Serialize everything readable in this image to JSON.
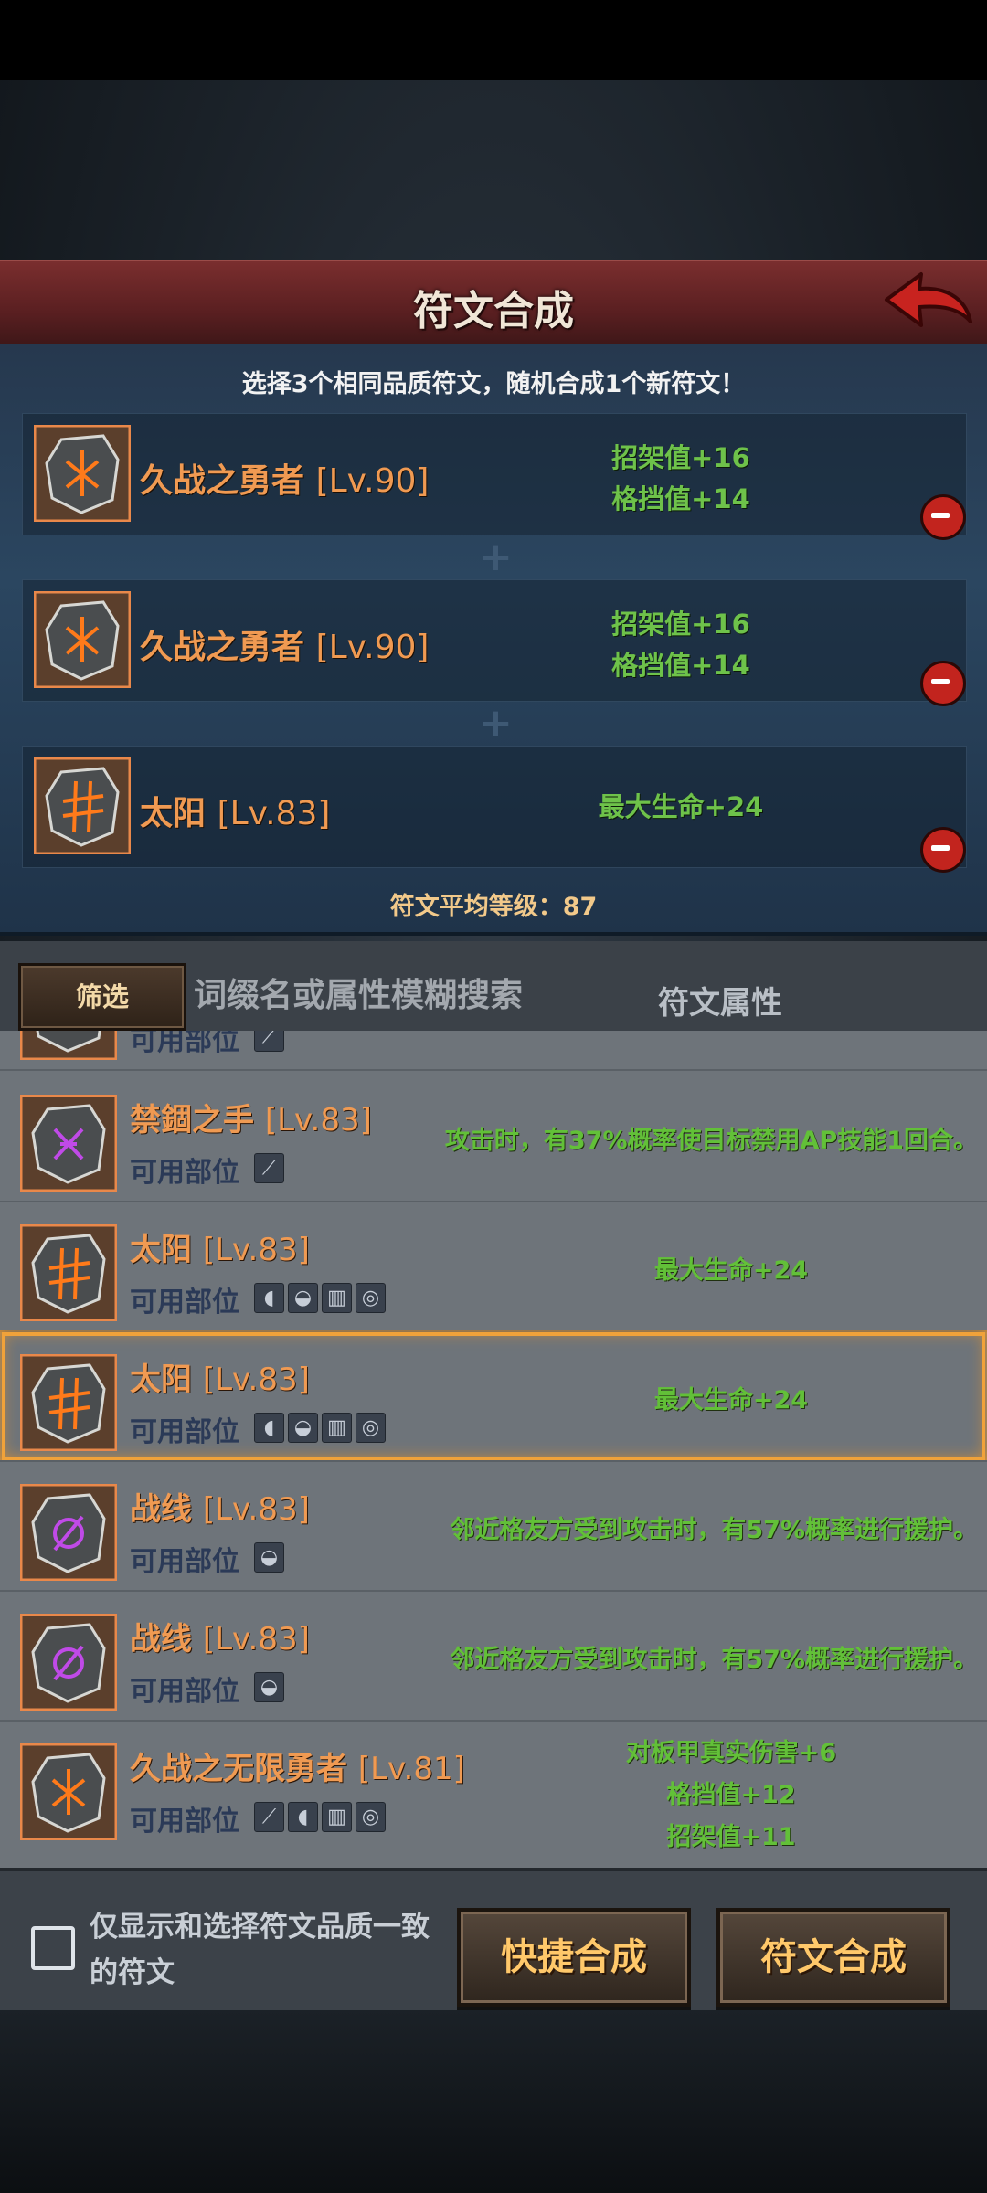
{
  "header": {
    "title": "符文合成"
  },
  "compose": {
    "instruction": "选择3个相同品质符文，随机合成1个新符文！",
    "slots": [
      {
        "name": "久战之勇者",
        "level": "[Lv.90]",
        "attrs": [
          "招架值+16",
          "格挡值+14"
        ]
      },
      {
        "name": "久战之勇者",
        "level": "[Lv.90]",
        "attrs": [
          "招架值+16",
          "格挡值+14"
        ]
      },
      {
        "name": "太阳",
        "level": "[Lv.83]",
        "attrs": [
          "最大生命+24"
        ]
      }
    ],
    "avg_level": "符文平均等级：87"
  },
  "filter": {
    "filter_label": "筛选",
    "search_placeholder": "词缀名或属性模糊搜索",
    "attr_label": "符文属性"
  },
  "list": {
    "parts_label": "可用部位",
    "rows": [
      {
        "name": "禁錮之手",
        "level": "[Lv.83]",
        "effect": "攻击时，有37%概率使目标禁用AP技能1回合。"
      },
      {
        "name": "太阳",
        "level": "[Lv.83]",
        "effect": "最大生命+24"
      },
      {
        "name": "太阳",
        "level": "[Lv.83]",
        "effect": "最大生命+24"
      },
      {
        "name": "战线",
        "level": "[Lv.83]",
        "effect": "邻近格友方受到攻击时，有57%概率进行援护。"
      },
      {
        "name": "战线",
        "level": "[Lv.83]",
        "effect": "邻近格友方受到攻击时，有57%概率进行援护。"
      },
      {
        "name": "久战之无限勇者",
        "level": "[Lv.81]",
        "effects": [
          "对板甲真实伤害+6",
          "格挡值+12",
          "招架值+11"
        ]
      }
    ]
  },
  "bottom": {
    "checkbox_label": "仅显示和选择符文品质一致的符文",
    "quick_compose": "快捷合成",
    "compose": "符文合成"
  },
  "colors": {
    "rune_name": "#f09a52",
    "attr_green": "#6ec24a",
    "header_red": "#7a2e2e",
    "selected_outline": "#f0a23a"
  }
}
